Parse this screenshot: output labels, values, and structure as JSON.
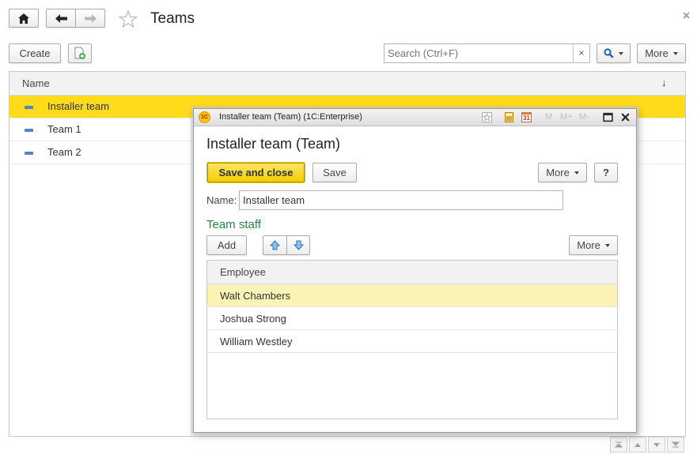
{
  "header": {
    "title": "Teams"
  },
  "toolbar": {
    "create_label": "Create",
    "search_placeholder": "Search (Ctrl+F)",
    "search_clear": "×",
    "more_label": "More"
  },
  "list": {
    "column_name": "Name",
    "sort_indicator": "↓",
    "rows": [
      {
        "label": "Installer team"
      },
      {
        "label": "Team 1"
      },
      {
        "label": "Team 2"
      }
    ]
  },
  "dialog": {
    "window_title": "Installer team (Team)  (1C:Enterprise)",
    "app_badge": "1C",
    "heading": "Installer team (Team)",
    "save_close_label": "Save and close",
    "save_label": "Save",
    "more_label": "More",
    "help_label": "?",
    "name_label": "Name:",
    "name_value": "Installer team",
    "section_title": "Team staff",
    "add_label": "Add",
    "grid_more_label": "More",
    "grid_column": "Employee",
    "employees": [
      {
        "name": "Walt Chambers"
      },
      {
        "name": "Joshua Strong"
      },
      {
        "name": "William Westley"
      }
    ],
    "title_buttons": {
      "m": "M",
      "m_plus": "M+",
      "m_minus": "M-",
      "calendar": "31"
    }
  },
  "colors": {
    "selected_row": "#ffdb1c",
    "grid_selected_row": "#fbf3b5",
    "primary_button": "#f5d920",
    "section_title": "#21883f",
    "accent_blue": "#4a86c5"
  }
}
